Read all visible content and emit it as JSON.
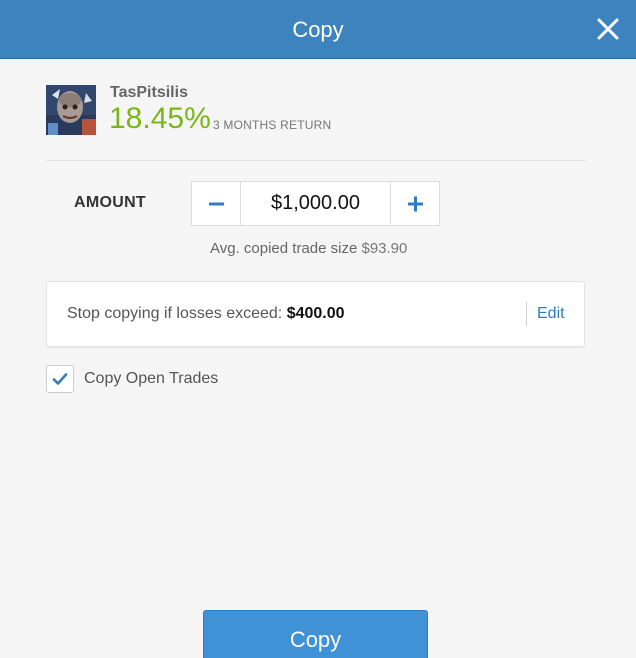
{
  "header": {
    "title": "Copy",
    "close_icon": "close-icon"
  },
  "trader": {
    "name": "TasPitsilis",
    "return_value": "18.45%",
    "return_label": "3 MONTHS RETURN",
    "avatar_icon": "avatar"
  },
  "amount": {
    "label": "AMOUNT",
    "value": "$1,000.00",
    "decrement_icon": "minus-icon",
    "increment_icon": "plus-icon",
    "avg_label": "Avg. copied trade size",
    "avg_value": "$93.90"
  },
  "stop_loss": {
    "label": "Stop copying if losses exceed:",
    "value": "$400.00",
    "edit_label": "Edit"
  },
  "copy_open_trades": {
    "label": "Copy Open Trades",
    "checked": true
  },
  "footer": {
    "copy_button_label": "Copy"
  },
  "colors": {
    "header_bg": "#3d84bf",
    "return_green": "#7cb518",
    "accent_blue": "#2f7cc0",
    "button_blue": "#3f92d6"
  }
}
